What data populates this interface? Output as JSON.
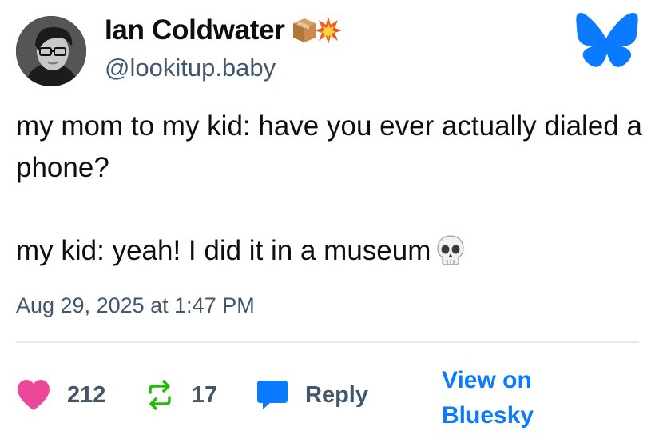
{
  "author": {
    "display_name": "Ian Coldwater",
    "name_emoji": [
      "package-emoji",
      "collision-emoji"
    ],
    "handle": "@lookitup.baby"
  },
  "post": {
    "line1": "my mom to my kid: have you ever actually dialed a phone?",
    "line2": "my kid: yeah! I did it in a museum",
    "trailing_emoji": "skull-emoji",
    "timestamp": "Aug 29, 2025 at 1:47 PM"
  },
  "actions": {
    "likes": "212",
    "reposts": "17",
    "reply_label": "Reply",
    "view_on_bluesky": "View on Bluesky"
  },
  "colors": {
    "brand_blue": "#0a7aff",
    "like_pink": "#ec4899",
    "repost_green": "#20bc07",
    "muted": "#42576c"
  }
}
